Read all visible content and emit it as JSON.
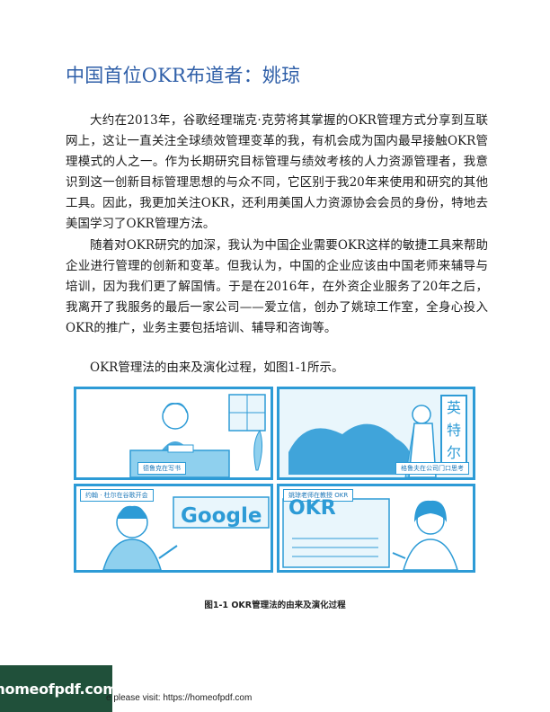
{
  "heading": "中国首位OKR布道者：姚琼",
  "paragraphs": [
    "大约在2013年，谷歌经理瑞克·克劳将其掌握的OKR管理方式分享到互联网上，这让一直关注全球绩效管理变革的我，有机会成为国内最早接触OKR管理模式的人之一。作为长期研究目标管理与绩效考核的人力资源管理者，我意识到这一创新目标管理思想的与众不同，它区别于我20年来使用和研究的其他工具。因此，我更加关注OKR，还利用美国人力资源协会会员的身份，特地去美国学习了OKR管理方法。",
    "随着对OKR研究的加深，我认为中国企业需要OKR这样的敏捷工具来帮助企业进行管理的创新和变革。但我认为，中国的企业应该由中国老师来辅导与培训，因为我们更了解国情。于是在2016年，在外资企业服务了20年之后，我离开了我服务的最后一家公司——爱立信，创办了姚琼工作室，全身心投入OKR的推广，业务主要包括培训、辅导和咨询等。",
    "OKR管理法的由来及演化过程，如图1-1所示。"
  ],
  "figure": {
    "panels": [
      {
        "caption": "德鲁克在写书"
      },
      {
        "caption": "格鲁夫在公司门口思考",
        "sign": [
          "英",
          "特",
          "尔"
        ]
      },
      {
        "caption": "约翰 · 杜尔在谷歌开会",
        "brand": "Google"
      },
      {
        "caption": "姚琼老师在教授 OKR",
        "brand": "OKR"
      }
    ],
    "caption": "图1-1 OKR管理法的由来及演化过程",
    "accent_color": "#2d9bd6"
  },
  "watermark": {
    "logo_text": "homeofpdf.com",
    "footer_text": "e please visit: https://homeofpdf.com"
  }
}
